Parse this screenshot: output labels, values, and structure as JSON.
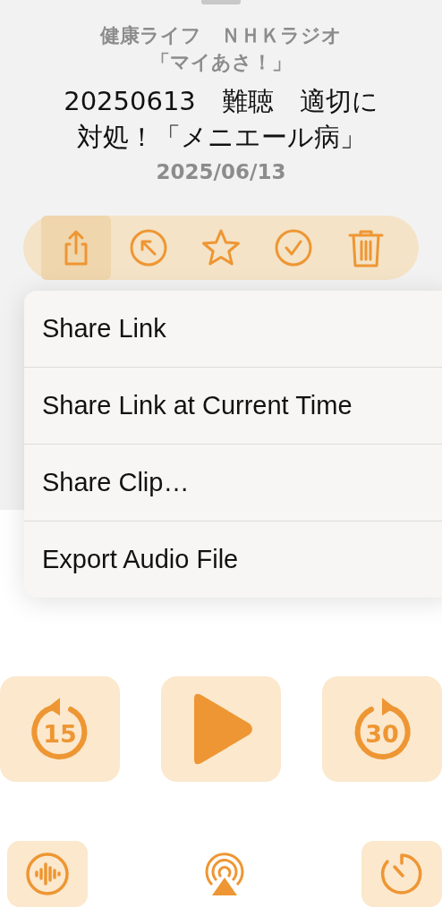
{
  "episode": {
    "show": "健康ライフ　ＮＨＫラジオ「マイあさ！」",
    "title": "20250613　難聴　適切に対処！「メニエール病」",
    "date": "2025/06/13"
  },
  "actions": [
    {
      "kind": "share",
      "selected": true
    },
    {
      "kind": "goto",
      "selected": false
    },
    {
      "kind": "star",
      "selected": false
    },
    {
      "kind": "check",
      "selected": false
    },
    {
      "kind": "trash",
      "selected": false
    }
  ],
  "share_menu": [
    {
      "label": "Share Link"
    },
    {
      "label": "Share Link at Current Time"
    },
    {
      "label": "Share Clip…"
    },
    {
      "label": "Export Audio File"
    }
  ],
  "transport": [
    {
      "kind": "back",
      "label": "15"
    },
    {
      "kind": "play"
    },
    {
      "kind": "forward",
      "label": "30"
    }
  ],
  "bottom_bar": [
    {
      "kind": "wave"
    },
    {
      "kind": "airplay"
    },
    {
      "kind": "timer"
    }
  ]
}
